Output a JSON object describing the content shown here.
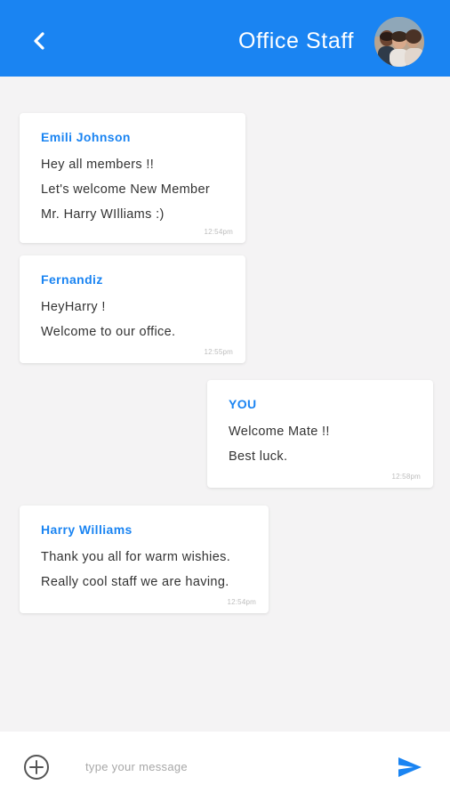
{
  "header": {
    "title": "Office Staff",
    "back_icon": "chevron-left-icon",
    "avatar": "group-avatar"
  },
  "colors": {
    "accent": "#1a84f2",
    "background": "#f4f3f4",
    "bubble": "#ffffff"
  },
  "messages": [
    {
      "sender": "Emili Johnson",
      "lines": [
        "Hey all members !!",
        "Let's welcome New Member",
        "Mr. Harry WIlliams :)"
      ],
      "time": "12:54pm",
      "outgoing": false
    },
    {
      "sender": "Fernandiz",
      "lines": [
        "HeyHarry !",
        "Welcome to our office."
      ],
      "time": "12:55pm",
      "outgoing": false
    },
    {
      "sender": "YOU",
      "lines": [
        "Welcome Mate !!",
        "Best luck."
      ],
      "time": "12:58pm",
      "outgoing": true
    },
    {
      "sender": "Harry Williams",
      "lines": [
        "Thank you all for warm wishies.",
        "Really cool staff we are having."
      ],
      "time": "12:54pm",
      "outgoing": false
    }
  ],
  "composer": {
    "placeholder": "type your message",
    "value": "",
    "add_icon": "plus-circle-icon",
    "send_icon": "send-icon"
  }
}
